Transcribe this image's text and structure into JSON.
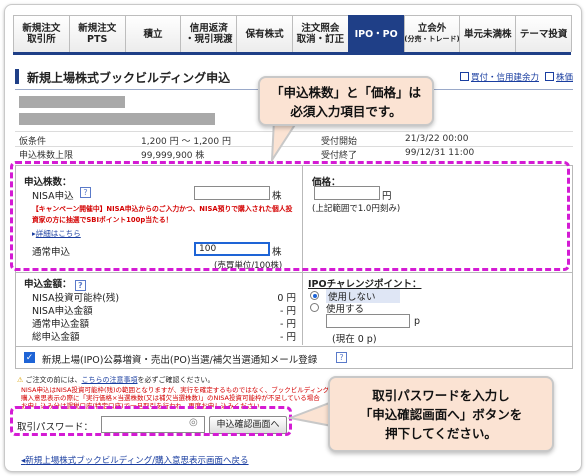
{
  "tabs": [
    {
      "l1": "新規注文",
      "l2": "取引所",
      "active": false
    },
    {
      "l1": "新規注文",
      "l2": "PTS",
      "active": false
    },
    {
      "l1": "積立",
      "l2": "",
      "active": false
    },
    {
      "l1": "信用返済",
      "l2": "・現引現渡",
      "active": false
    },
    {
      "l1": "保有株式",
      "l2": "",
      "active": false
    },
    {
      "l1": "注文照会",
      "l2": "取消・訂正",
      "active": false
    },
    {
      "l1": "IPO・PO",
      "l2": "",
      "active": true
    },
    {
      "l1": "立会外",
      "l2": "(分売・トレード)",
      "active": false
    },
    {
      "l1": "単元未満株",
      "l2": "",
      "active": false
    },
    {
      "l1": "テーマ投資",
      "l2": "",
      "active": false
    }
  ],
  "title": "新規上場株式ブックビルディング申込",
  "links": [
    "買付・信用建余力",
    "株価"
  ],
  "info": {
    "cond_label": "仮条件",
    "cond_value": "1,200 円 ～ 1,200 円",
    "start_label": "受付開始",
    "start_value": "21/3/22 00:00",
    "limit_label": "申込株数上限",
    "limit_value": "99,999,900 株",
    "end_label": "受付終了",
    "end_value": "99/12/31 11:00"
  },
  "form": {
    "qty_label": "申込株数：",
    "nisa_label": "NISA申込",
    "unit_kabu": "株",
    "campaign": "【キャンペーン開催中】NISA申込からのご入力かつ、NISA預りで購入された個人投資家の方に抽選でSBIポイント100p当たる！",
    "detail_link": "詳細はこちら",
    "normal_label": "通常申込",
    "normal_value": "100",
    "unit_note": "(売買単位/100株)",
    "price_label": "価格：",
    "unit_yen": "円",
    "price_note": "(上記範囲で1.0円刻み)",
    "amount_label": "申込金額：",
    "amount_rows": [
      {
        "label": "NISA投資可能枠(残)",
        "value": "0 円"
      },
      {
        "label": "NISA申込金額",
        "value": "- 円"
      },
      {
        "label": "通常申込金額",
        "value": "- 円"
      },
      {
        "label": "総申込金額",
        "value": "- 円"
      }
    ],
    "ipo_label": "IPOチャレンジポイント：",
    "ipo_opt1": "使用しない",
    "ipo_opt2": "使用する",
    "unit_p": "p",
    "ipo_current": "(現在 0 p)",
    "mail_check": "新規上場(IPO)公募増資・売出(PO)当選/補欠当選通知メール登録",
    "notice_head": "ご注文の前には、",
    "notice_link": "こちらの注意事項",
    "notice_tail": "を必ずご確認ください。",
    "red_notice_1": "NISA申込はNISA投資可能枠(残)の範囲となりますが、実行を確定するものではなく、ブックビルディング",
    "red_notice_2": "購入意思表示の際に「実行価格×当選株数(又は補欠当選株数)」のNISA投資可能枠が不足している場合",
    "red_notice_3": "お申し込み分は課税口座(特定口座)で一旦取引を行われ、再度お申し込みください。",
    "pw_label": "取引パスワード：",
    "confirm_btn": "申込確認画面へ"
  },
  "bottom_link": "新規上場株式ブックビルディング/購入意思表示画面へ戻る",
  "callout1": [
    "「申込株数」と「価格」は",
    "必須入力項目です。"
  ],
  "callout2": [
    "取引パスワードを入力し",
    "「申込確認画面へ」ボタンを",
    "押下してください。"
  ],
  "colors": {
    "brand": "#1f3f87",
    "annotation": "#d41bd4",
    "callout_bg": "#fbe3d3",
    "alert": "#d40000"
  }
}
